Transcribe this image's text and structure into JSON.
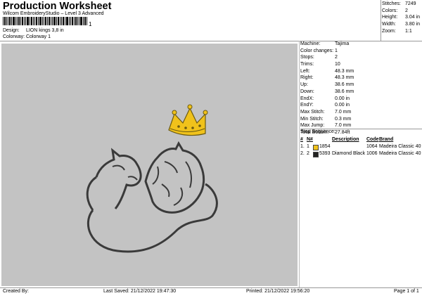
{
  "header": {
    "title": "Production Worksheet",
    "subtitle": "Wilcom EmbroideryStudio – Level 3 Advanced",
    "barcode_mark": "1",
    "design_label": "Design:",
    "design_value": "LION kings 3,8 in",
    "colorway_label": "Colorway:",
    "colorway_value": "Colorway 1"
  },
  "stats": [
    {
      "label": "Stitches:",
      "value": "7249"
    },
    {
      "label": "Colors:",
      "value": "2"
    },
    {
      "label": "Height:",
      "value": "3.04 in"
    },
    {
      "label": "Width:",
      "value": "3.80 in"
    },
    {
      "label": "Zoom:",
      "value": "1:1"
    }
  ],
  "info": [
    {
      "label": "Machine:",
      "value": "Tajima"
    },
    {
      "label": "Color changes:",
      "value": "1"
    },
    {
      "label": "Stops:",
      "value": "2"
    },
    {
      "label": "Trims:",
      "value": "10"
    },
    {
      "label": "Left:",
      "value": "48.3 mm"
    },
    {
      "label": "Right:",
      "value": "48.3 mm"
    },
    {
      "label": "Up:",
      "value": "38.6 mm"
    },
    {
      "label": "Down:",
      "value": "38.6 mm"
    },
    {
      "label": "EndX:",
      "value": "0.00 in"
    },
    {
      "label": "EndY:",
      "value": "0.00 in"
    },
    {
      "label": "Max Stitch:",
      "value": "7.0 mm"
    },
    {
      "label": "Min Stitch:",
      "value": "0.3 mm"
    },
    {
      "label": "Max Jump:",
      "value": "7.0 mm"
    },
    {
      "label": "Total Bobbin:",
      "value": "27.84ft"
    }
  ],
  "stop_sequence": {
    "title": "Stop Sequence:",
    "headers": {
      "num": "#",
      "n": "N#",
      "description": "Description",
      "code": "Code",
      "brand": "Brand"
    },
    "rows": [
      {
        "num": "1.",
        "n": "1",
        "color": "#f0c21b",
        "id": "1854",
        "description": "",
        "code": "1064",
        "brand": "Madeira Classic 40"
      },
      {
        "num": "2.",
        "n": "2",
        "color": "#222222",
        "id": "5393",
        "description": "Diamond Black",
        "code": "1006",
        "brand": "Madeira Classic 40"
      }
    ]
  },
  "footer": {
    "created_by": "Created By:",
    "last_saved": "Last Saved: 21/12/2022 19:47:30",
    "printed": "Printed: 21/12/2022 19:56:20",
    "page": "Page 1 of 1"
  },
  "colors": {
    "canvas_bg": "#c3c3c3",
    "crown": "#f0c21b",
    "outline": "#3a3a3a"
  }
}
